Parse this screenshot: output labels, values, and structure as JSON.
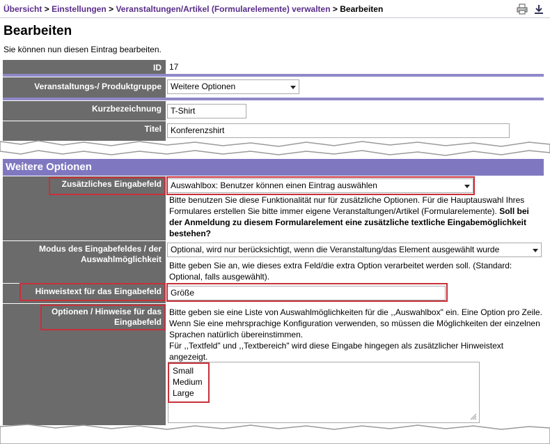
{
  "breadcrumb": {
    "items": [
      "Übersicht",
      "Einstellungen",
      "Veranstaltungen/Artikel (Formularelemente) verwalten"
    ],
    "separator": ">",
    "current": "Bearbeiten"
  },
  "toolbar": {
    "print_icon": "print-icon",
    "download_icon": "download-icon"
  },
  "page": {
    "title": "Bearbeiten",
    "subtitle": "Sie können nun diesen Eintrag bearbeiten."
  },
  "fields": {
    "id_label": "ID",
    "id_value": "17",
    "group_label": "Veranstaltungs-/ Produktgruppe",
    "group_value": "Weitere Optionen",
    "short_label": "Kurzbezeichnung",
    "short_value": "T-Shirt",
    "title_label": "Titel",
    "title_value": "Konferenzshirt"
  },
  "section": {
    "heading": "Weitere Optionen",
    "extra_field_label": "Zusätzliches Eingabefeld",
    "extra_field_value": "Auswahlbox: Benutzer können einen Eintrag auswählen",
    "extra_field_help_1": "Bitte benutzen Sie diese Funktionalität nur für zusätzliche Optionen. Für die Hauptauswahl Ihres Formulares erstellen Sie bitte immer eigene Veranstaltungen/Artikel (Formularelemente).",
    "extra_field_help_bold": "Soll bei der Anmeldung zu diesem Formularelement eine zusätzliche textliche Eingabemöglichkeit bestehen?",
    "mode_label": "Modus des Eingabefeldes / der Auswahlmöglichkeit",
    "mode_value": "Optional, wird nur berücksichtigt, wenn die Veranstaltung/das Element ausgewählt wurde",
    "mode_help": "Bitte geben Sie an, wie dieses extra Feld/die extra Option verarbeitet werden soll. (Standard: Optional, falls ausgewählt).",
    "hint_label": "Hinweistext für das Eingabefeld",
    "hint_value": "Größe",
    "options_label": "Optionen / Hinweise für das Eingabefeld",
    "options_help_1": "Bitte geben sie eine Liste von Auswahlmöglichkeiten für die ,,Auswahlbox\" ein. Eine Option pro Zeile. Wenn Sie eine mehrsprachige Konfiguration verwenden, so müssen die Möglichkeiten der einzelnen Sprachen natürlich übereinstimmen.",
    "options_help_2": "Für ,,Textfeld\" und ,,Textbereich\" wird diese Eingabe hingegen als zusätzlicher Hinweistext angezeigt.",
    "options_values": [
      "Small",
      "Medium",
      "Large"
    ]
  },
  "colors": {
    "label_bg": "#6b6b6b",
    "separator": "#8f88c8",
    "section_head": "#7f78c0",
    "highlight": "#c8303a",
    "link": "#5a2d8a"
  }
}
